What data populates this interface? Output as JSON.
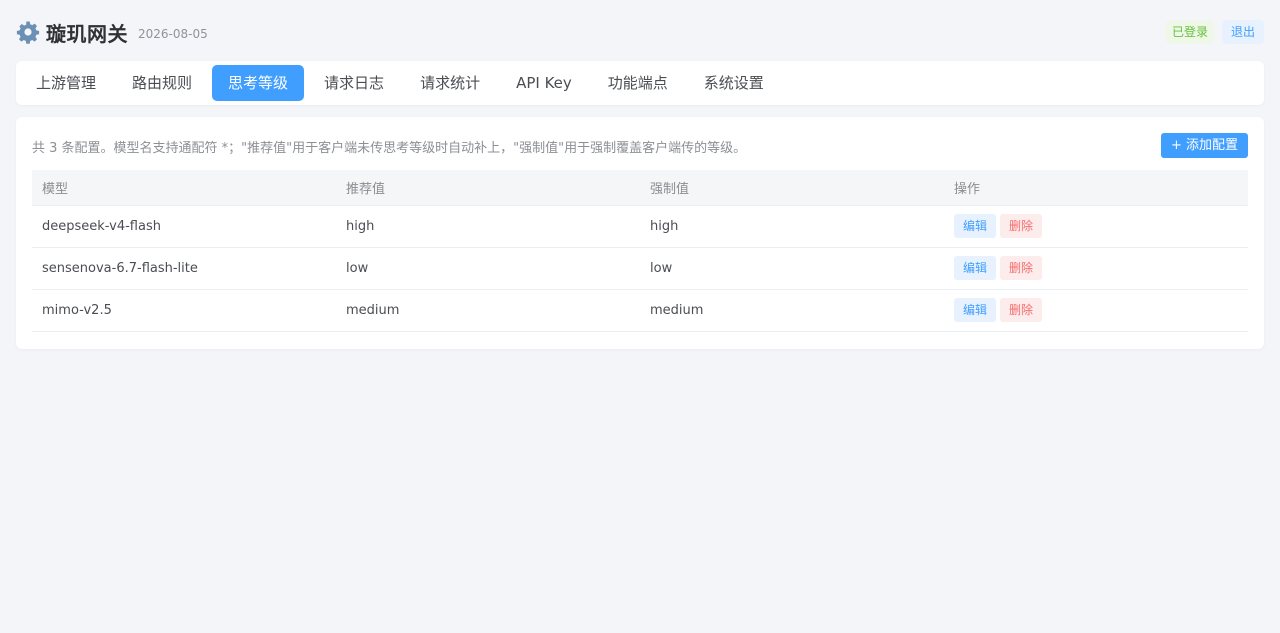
{
  "app": {
    "title": "璇玑网关",
    "date": "2026-08-05",
    "login_status": "已登录",
    "logout_label": "退出",
    "icon": "gear-icon"
  },
  "tabs": [
    {
      "label": "上游管理",
      "active": false
    },
    {
      "label": "路由规则",
      "active": false
    },
    {
      "label": "思考等级",
      "active": true
    },
    {
      "label": "请求日志",
      "active": false
    },
    {
      "label": "请求统计",
      "active": false
    },
    {
      "label": "API Key",
      "active": false
    },
    {
      "label": "功能端点",
      "active": false
    },
    {
      "label": "系统设置",
      "active": false
    }
  ],
  "panel": {
    "description": "共 3 条配置。模型名支持通配符 *；\"推荐值\"用于客户端未传思考等级时自动补上，\"强制值\"用于强制覆盖客户端传的等级。",
    "add_label": "+ 添加配置"
  },
  "table": {
    "columns": [
      "模型",
      "推荐值",
      "强制值",
      "操作"
    ],
    "rows": [
      {
        "model": "deepseek-v4-flash",
        "recommended": "high",
        "forced": "high"
      },
      {
        "model": "sensenova-6.7-flash-lite",
        "recommended": "low",
        "forced": "low"
      },
      {
        "model": "mimo-v2.5",
        "recommended": "medium",
        "forced": "medium"
      }
    ],
    "edit_label": "编辑",
    "delete_label": "删除"
  },
  "colors": {
    "accent": "#409eff",
    "danger": "#f56c6c",
    "success": "#67c23a",
    "background": "#f4f5f9"
  }
}
